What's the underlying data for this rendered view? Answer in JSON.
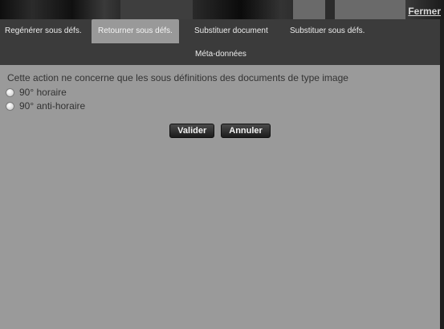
{
  "header": {
    "close_label": "Fermer"
  },
  "tabs": [
    {
      "label": "Regénérer sous défs.",
      "active": false
    },
    {
      "label": "Retourner sous défs.",
      "active": true
    },
    {
      "label": "Substituer document",
      "active": false
    },
    {
      "label": "Substituer sous défs.",
      "active": false
    },
    {
      "label": "Méta-données",
      "active": false
    }
  ],
  "form": {
    "info_text": "Cette action ne concerne que les sous définitions des documents de type image",
    "options": [
      {
        "label": "90° horaire",
        "checked": false
      },
      {
        "label": "90° anti-horaire",
        "checked": false
      }
    ],
    "submit_label": "Valider",
    "cancel_label": "Annuler"
  },
  "colors": {
    "panel": "#9a9a9a",
    "tabbar": "#3b3b3b",
    "active_tab": "#999999"
  }
}
